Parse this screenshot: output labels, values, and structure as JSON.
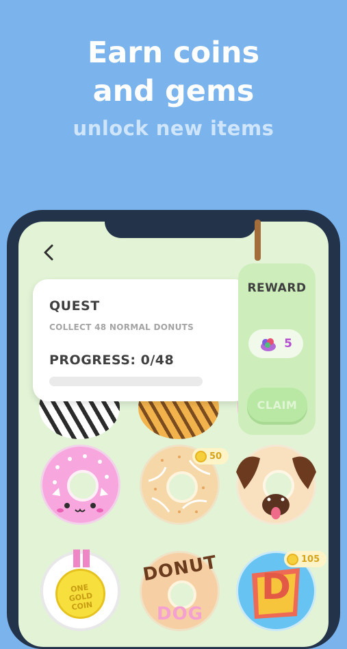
{
  "promo": {
    "line1": "Earn coins",
    "line2": "and gems",
    "subline": "unlock new items"
  },
  "quest": {
    "title": "QUEST",
    "description": "COLLECT 48 NORMAL DONUTS",
    "progress_label": "PROGRESS: 0/48",
    "progress_fraction": 0
  },
  "reward": {
    "title": "REWARD",
    "gem_count": "5",
    "claim_label": "CLAIM",
    "claim_enabled": false
  },
  "donuts": [
    {
      "name": "zebra donut"
    },
    {
      "name": "tiger donut"
    },
    {
      "name": "pink bunny donut"
    },
    {
      "name": "bagel donut",
      "price": "50"
    },
    {
      "name": "pug donut"
    },
    {
      "name": "gold coin donut",
      "text": "ONE GOLD COIN"
    },
    {
      "name": "donut dog donut",
      "text_top": "DONUT",
      "text_bottom": "DOG"
    },
    {
      "name": "super d donut",
      "letter": "D",
      "price": "105"
    }
  ],
  "icons": {
    "back": "chevron-left-icon",
    "gem": "gem-icon",
    "coin": "coin-icon"
  },
  "colors": {
    "background": "#7bb3ec",
    "phone": "#23334a",
    "screen": "#e2f3d6",
    "reward_panel": "#cdeebb",
    "gem_text": "#b44fd0",
    "coin": "#f6cf3c"
  }
}
